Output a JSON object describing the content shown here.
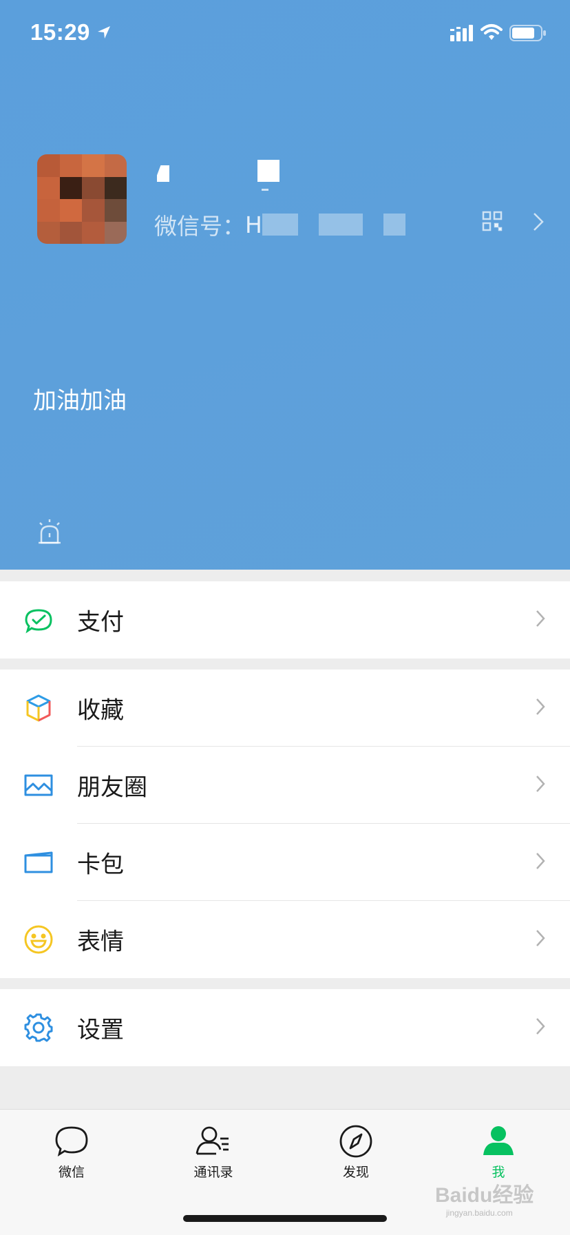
{
  "status_bar": {
    "time": "15:29"
  },
  "profile": {
    "wechat_id_label": "微信号：",
    "wechat_id_value": "H",
    "signature": "加油加油"
  },
  "menu": {
    "pay": "支付",
    "favorites": "收藏",
    "moments": "朋友圈",
    "cards": "卡包",
    "stickers": "表情",
    "settings": "设置"
  },
  "tabbar": {
    "chats": "微信",
    "contacts": "通讯录",
    "discover": "发现",
    "me": "我"
  },
  "colors": {
    "header_bg": "#5b9fdc",
    "accent_green": "#07c160"
  },
  "watermark": {
    "brand": "Baidu经验",
    "url": "jingyan.baidu.com"
  }
}
